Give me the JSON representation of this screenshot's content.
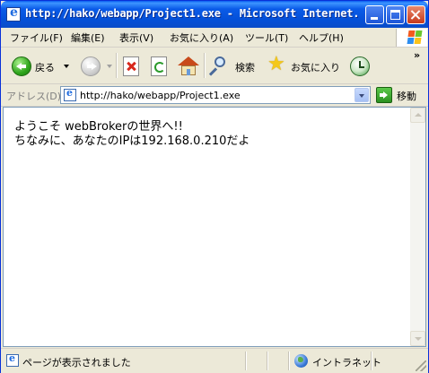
{
  "window": {
    "title": "http://hako/webapp/Project1.exe - Microsoft Internet..."
  },
  "menubar": {
    "items": [
      {
        "label": "ファイル(F)"
      },
      {
        "label": "編集(E)"
      },
      {
        "label": "表示(V)"
      },
      {
        "label": "お気に入り(A)"
      },
      {
        "label": "ツール(T)"
      },
      {
        "label": "ヘルプ(H)"
      }
    ]
  },
  "toolbar": {
    "back_label": "戻る",
    "search_label": "検索",
    "favorites_label": "お気に入り",
    "overflow_label": "»",
    "icons": {
      "back": "back-arrow-icon",
      "forward": "forward-arrow-icon",
      "stop": "stop-icon",
      "refresh": "refresh-icon",
      "home": "home-icon",
      "search": "search-icon",
      "favorites": "favorites-star-icon",
      "history": "history-icon"
    }
  },
  "address": {
    "label": "アドレス(D)",
    "url": "http://hako/webapp/Project1.exe",
    "go_label": "移動"
  },
  "content": {
    "line1": "ようこそ webBrokerの世界へ!!",
    "line2": "ちなみに、あなたのIPは192.168.0.210だよ"
  },
  "statusbar": {
    "message": "ページが表示されました",
    "zone": "イントラネット"
  },
  "colors": {
    "titlebar": "#0a5be8",
    "window_bg": "#ece9d8",
    "content_bg": "#ffffff"
  }
}
